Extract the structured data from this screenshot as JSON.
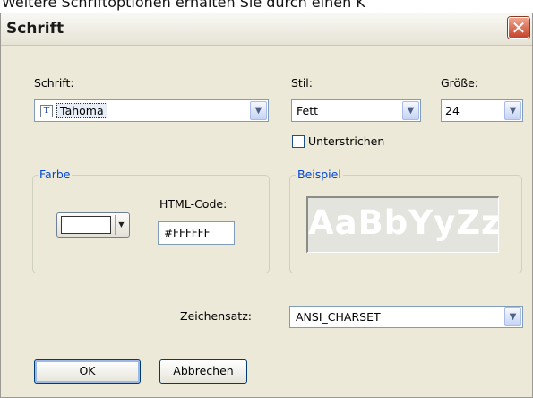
{
  "background": {
    "caption": "Weitere Schriftoptionen erhalten Sie durch einen K"
  },
  "dialog": {
    "title": "Schrift",
    "close_glyph": "✕"
  },
  "font": {
    "label": "Schrift:",
    "value": "Tahoma",
    "icon": "truetype-font-icon",
    "icon_glyph": "T"
  },
  "style": {
    "label": "Stil:",
    "value": "Fett"
  },
  "size": {
    "label": "Größe:",
    "value": "24"
  },
  "underline": {
    "label": "Unterstrichen",
    "checked": false
  },
  "color_group": {
    "legend": "Farbe",
    "html_code_label": "HTML-Code:",
    "html_code_value": "#FFFFFF",
    "swatch_color": "#FFFFFF"
  },
  "preview_group": {
    "legend": "Beispiel",
    "sample_text": "AaBbYyZz"
  },
  "charset": {
    "label": "Zeichensatz:",
    "value": "ANSI_CHARSET"
  },
  "buttons": {
    "ok": "OK",
    "cancel": "Abbrechen"
  },
  "dropdown_glyph": "▼"
}
